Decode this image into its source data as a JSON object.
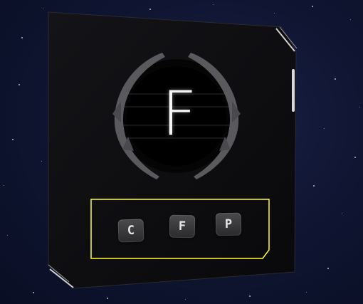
{
  "display": {
    "current_letter": "F"
  },
  "options": [
    {
      "label": "C"
    },
    {
      "label": "F"
    },
    {
      "label": "P"
    }
  ],
  "colors": {
    "selection_outline": "#ffff33",
    "panel": "#0e0e11",
    "background": "#101633"
  }
}
